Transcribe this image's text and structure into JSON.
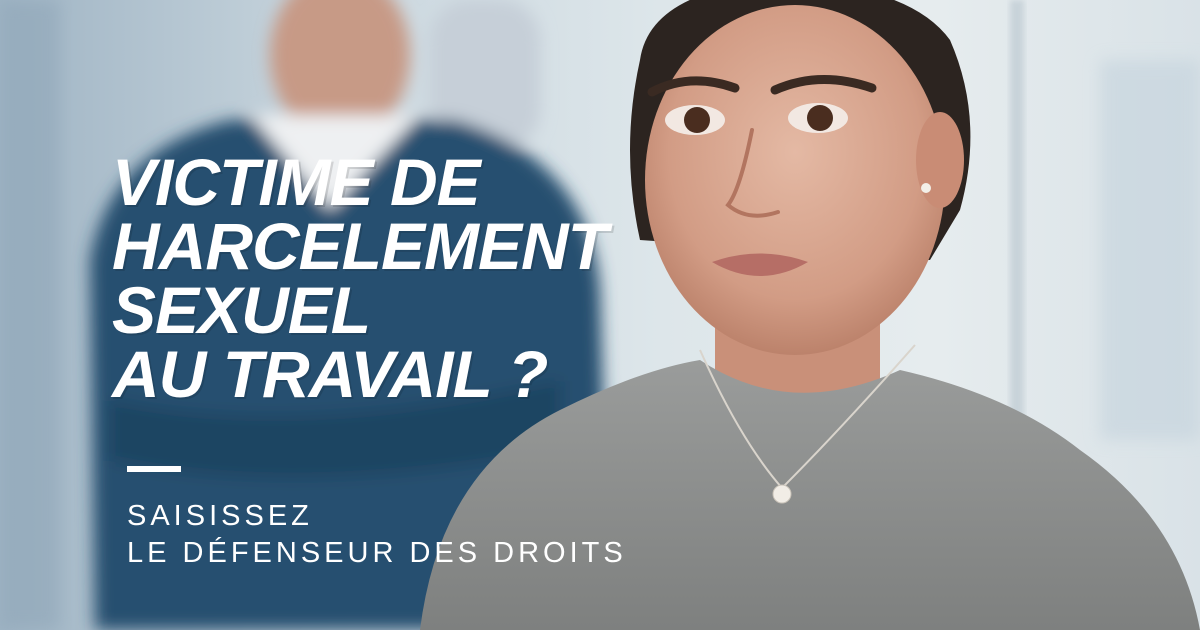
{
  "headline": {
    "line1": "VICTIME DE",
    "line2": "HARCELEMENT",
    "line3": " SEXUEL",
    "line4": "AU TRAVAIL ?"
  },
  "cta": {
    "line1": "SAISISSEZ",
    "line2": "LE DÉFENSEUR DES DROITS"
  },
  "colors": {
    "text": "#ffffff",
    "sweater": "#8a8c8c",
    "jacket": "#254e6e"
  }
}
